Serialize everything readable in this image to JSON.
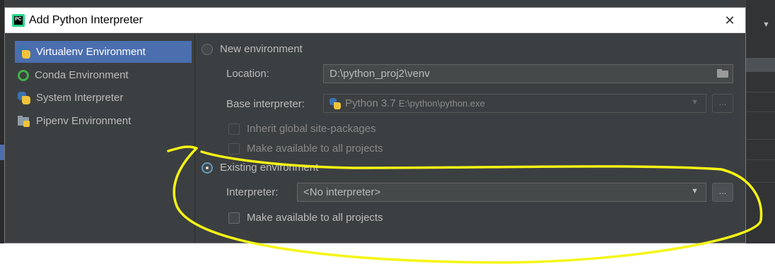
{
  "window": {
    "title": "Add Python Interpreter",
    "close_label": "✕",
    "app_icon_text": "PC"
  },
  "sidebar": {
    "items": [
      {
        "label": "Virtualenv Environment",
        "icon": "python-icon",
        "selected": true
      },
      {
        "label": "Conda Environment",
        "icon": "conda-icon",
        "selected": false
      },
      {
        "label": "System Interpreter",
        "icon": "python-icon",
        "selected": false
      },
      {
        "label": "Pipenv Environment",
        "icon": "pipenv-folder-icon",
        "selected": false
      }
    ]
  },
  "new_env": {
    "radio_label": "New environment",
    "selected": false,
    "location_label": "Location:",
    "location_value": "D:\\python_proj2\\venv",
    "base_label": "Base interpreter:",
    "base_value_name": "Python 3.7",
    "base_value_path": "E:\\python\\python.exe",
    "browse_label": "...",
    "inherit_label": "Inherit global site-packages",
    "available_label": "Make available to all projects"
  },
  "existing_env": {
    "radio_label": "Existing environment",
    "selected": true,
    "interpreter_label": "Interpreter:",
    "interpreter_value": "<No interpreter>",
    "browse_label": "...",
    "available_label": "Make available to all projects"
  },
  "colors": {
    "dialog_bg": "#3c3f41",
    "selection": "#4b6eaf",
    "annotation": "#f5f516"
  }
}
